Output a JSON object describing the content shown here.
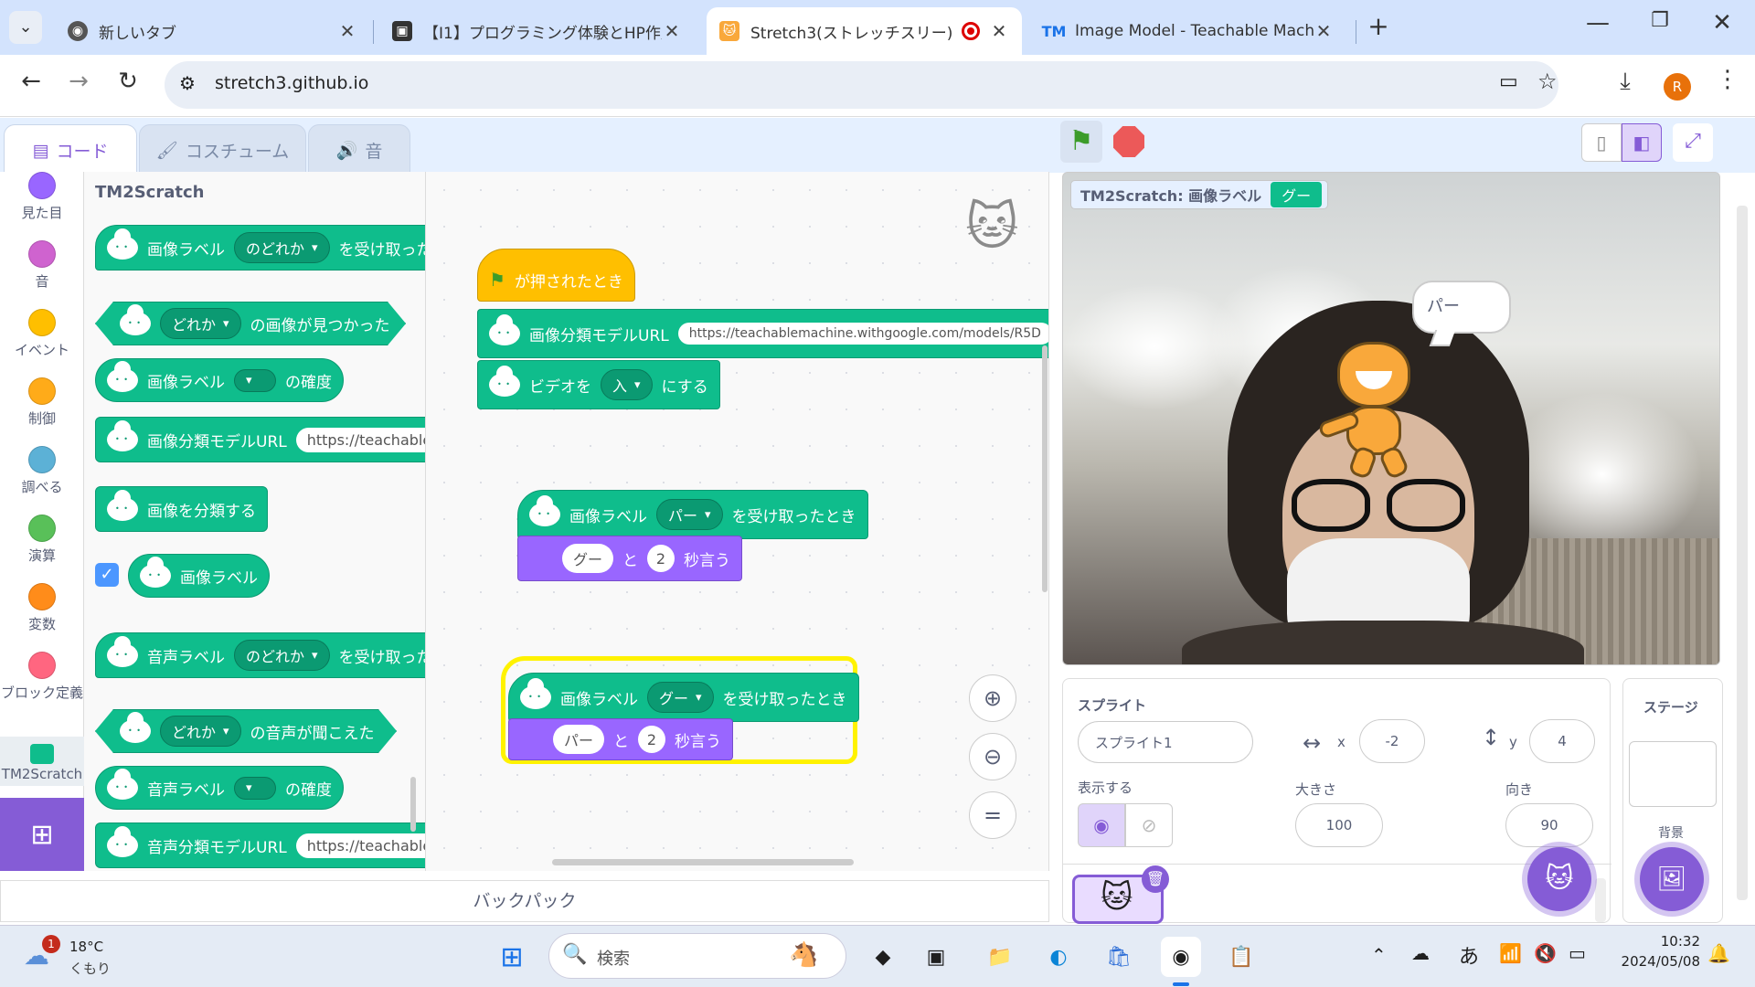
{
  "browser": {
    "tabs": [
      {
        "title": "新しいタブ"
      },
      {
        "title": "【I1】プログラミング体験とHP作成実"
      },
      {
        "title": "Stretch3(ストレッチスリー)"
      },
      {
        "title": "Image Model - Teachable Mach"
      }
    ],
    "address": "stretch3.github.io",
    "profile_initial": "R"
  },
  "scratch": {
    "tabs": {
      "code": "コード",
      "costume": "コスチューム",
      "sound": "音"
    },
    "categories": [
      "見た目",
      "音",
      "イベント",
      "制御",
      "調べる",
      "演算",
      "変数",
      "ブロック定義",
      "TM2Scratch"
    ],
    "palette": {
      "heading": "TM2Scratch",
      "blocks": [
        {
          "label": "画像ラベル",
          "dropdown": "のどれか",
          "suffix": "を受け取った"
        },
        {
          "dropdown": "どれか",
          "suffix": "の画像が見つかった"
        },
        {
          "label": "画像ラベル",
          "dropdown": "",
          "suffix": "の確度"
        },
        {
          "label": "画像分類モデルURL",
          "input": "https://teachablem"
        },
        {
          "label": "画像を分類する"
        },
        {
          "label": "画像ラベル"
        },
        {
          "label": "音声ラベル",
          "dropdown": "のどれか",
          "suffix": "を受け取った"
        },
        {
          "dropdown": "どれか",
          "suffix": "の音声が聞こえた"
        },
        {
          "label": "音声ラベル",
          "dropdown": "",
          "suffix": "の確度"
        },
        {
          "label": "音声分類モデルURL",
          "input": "https://teachablem"
        }
      ]
    },
    "script1": {
      "hat": "が押されたとき",
      "url_label": "画像分類モデルURL",
      "url_value": "https://teachablemachine.withgoogle.com/models/R5D",
      "video_label": "ビデオを",
      "video_value": "入",
      "video_suffix": "にする"
    },
    "script2": {
      "hat_label": "画像ラベル",
      "hat_value": "パー",
      "hat_suffix": "を受け取ったとき",
      "say_text": "グー",
      "say_and": "と",
      "say_secs": "2",
      "say_suffix": "秒言う"
    },
    "script3": {
      "hat_label": "画像ラベル",
      "hat_value": "グー",
      "hat_suffix": "を受け取ったとき",
      "say_text": "パー",
      "say_and": "と",
      "say_secs": "2",
      "say_suffix": "秒言う"
    },
    "backpack": "バックパック"
  },
  "stage": {
    "monitor_label": "TM2Scratch: 画像ラベル",
    "monitor_value": "グー",
    "speech": "パー"
  },
  "sprite_info": {
    "section": "スプライト",
    "name": "スプライト1",
    "x_label": "x",
    "x": "-2",
    "y_label": "y",
    "y": "4",
    "show_label": "表示する",
    "size_label": "大きさ",
    "size": "100",
    "direction_label": "向き",
    "direction": "90",
    "stage_label": "ステージ",
    "backdrop_label": "背景"
  },
  "taskbar": {
    "weather_temp": "18°C",
    "weather_desc": "くもり",
    "weather_badge": "1",
    "search_placeholder": "検索",
    "ime": "あ",
    "time": "10:32",
    "date": "2024/05/08"
  },
  "colors": {
    "accent": "#855cd6",
    "extension": "#0fbd8c",
    "looks": "#9966ff",
    "events": "#ffbf00"
  }
}
